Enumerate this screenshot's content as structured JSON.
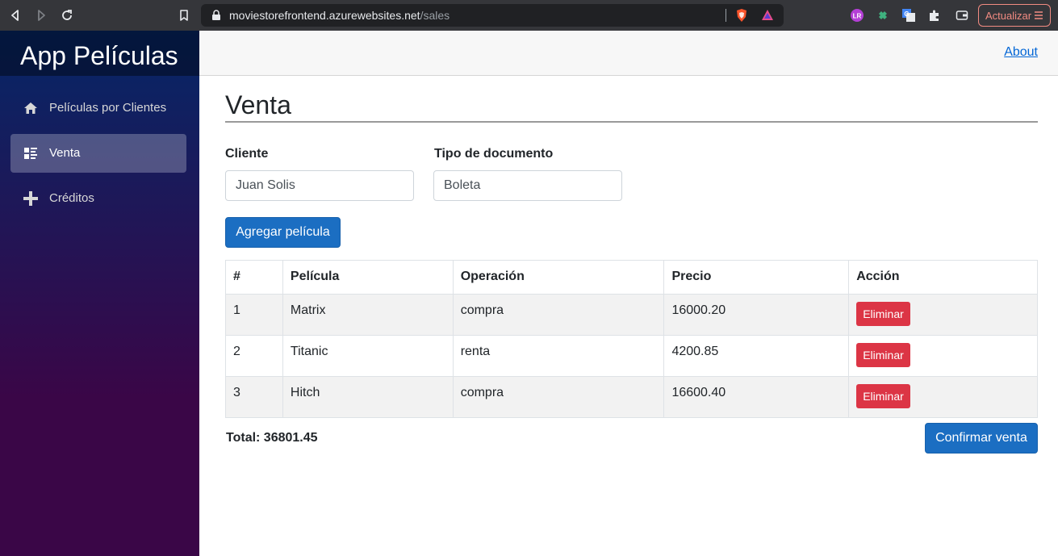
{
  "browser": {
    "url_domain": "moviestorefrontend.azurewebsites.net",
    "url_path": "/sales",
    "update_label": "Actualizar"
  },
  "sidebar": {
    "brand": "App Películas",
    "items": [
      {
        "label": "Películas por Clientes",
        "icon": "home-icon",
        "active": false
      },
      {
        "label": "Venta",
        "icon": "list-icon",
        "active": true
      },
      {
        "label": "Créditos",
        "icon": "plus-icon",
        "active": false
      }
    ]
  },
  "top_row": {
    "about_label": "About"
  },
  "main": {
    "title": "Venta",
    "cliente_label": "Cliente",
    "cliente_value": "Juan Solis",
    "tipo_doc_label": "Tipo de documento",
    "tipo_doc_value": "Boleta",
    "add_button": "Agregar película",
    "table": {
      "headers": [
        "#",
        "Película",
        "Operación",
        "Precio",
        "Acción"
      ],
      "rows": [
        {
          "num": "1",
          "pelicula": "Matrix",
          "operacion": "compra",
          "precio": "16000.20",
          "accion": "Eliminar"
        },
        {
          "num": "2",
          "pelicula": "Titanic",
          "operacion": "renta",
          "precio": "4200.85",
          "accion": "Eliminar"
        },
        {
          "num": "3",
          "pelicula": "Hitch",
          "operacion": "compra",
          "precio": "16600.40",
          "accion": "Eliminar"
        }
      ]
    },
    "total": "Total: 36801.45",
    "confirm_button": "Confirmar venta"
  },
  "colors": {
    "primary": "#1b6ec2",
    "danger": "#dc3545",
    "sidebar_top": "#052767",
    "sidebar_bottom": "#3a0647",
    "link": "#0366d6"
  }
}
